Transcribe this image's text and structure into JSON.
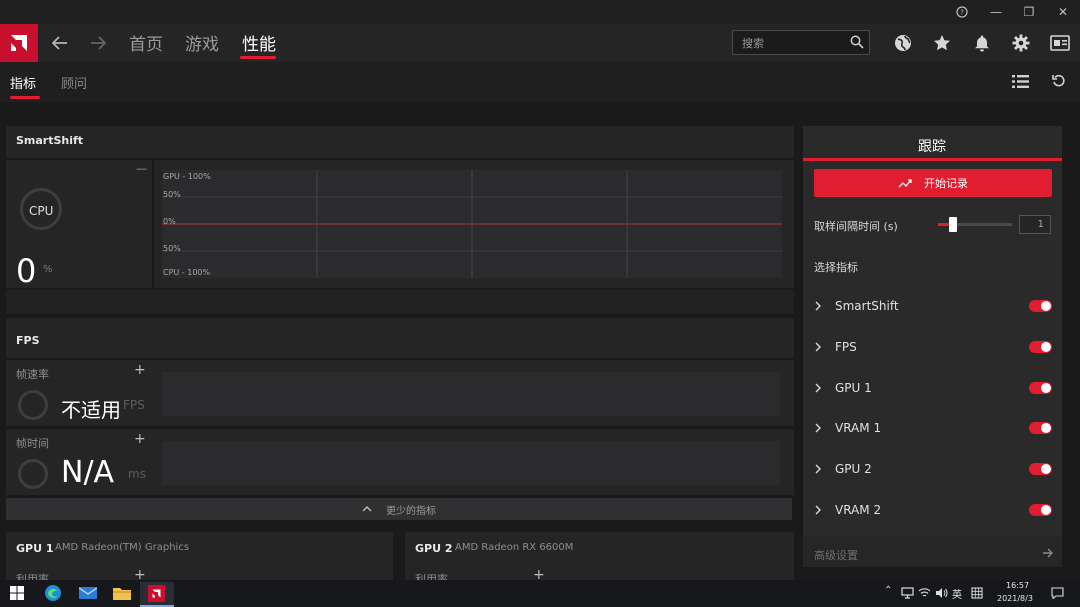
{
  "window": {
    "help_icon": "question-circle-icon",
    "minimize": "—",
    "restore": "❐",
    "close": "✕"
  },
  "nav": {
    "tabs": [
      {
        "label": "首页",
        "active": false
      },
      {
        "label": "游戏",
        "active": false
      },
      {
        "label": "性能",
        "active": true
      }
    ],
    "search_placeholder": "搜索",
    "accent": "#e11d32"
  },
  "subnav": {
    "tabs": [
      {
        "label": "指标",
        "active": true
      },
      {
        "label": "顾问",
        "active": false
      }
    ]
  },
  "smartshift": {
    "title": "SmartShift",
    "gauge_label": "CPU",
    "value": "0",
    "unit": "%",
    "collapse": "—",
    "graph_labels": [
      "GPU - 100%",
      "50%",
      "0%",
      "50%",
      "CPU - 100%"
    ]
  },
  "fps": {
    "title": "FPS",
    "rows": [
      {
        "label": "帧速率",
        "value": "不适用",
        "unit": "FPS",
        "add": "+"
      },
      {
        "label": "帧时间",
        "value": "N/A",
        "unit": "ms",
        "add": "+"
      }
    ],
    "fewer_metrics": "更少的指标"
  },
  "gpu_cards": [
    {
      "title": "GPU 1",
      "name": "AMD Radeon(TM) Graphics",
      "sub": "利用率",
      "add": "+"
    },
    {
      "title": "GPU 2",
      "name": "AMD Radeon RX 6600M",
      "sub": "利用率",
      "add": "+"
    }
  ],
  "tracking": {
    "title": "跟踪",
    "start_button": "开始记录",
    "interval_label": "取样间隔时间 (s)",
    "interval_value": "1",
    "select_metrics": "选择指标",
    "metrics": [
      {
        "label": "SmartShift",
        "enabled": true
      },
      {
        "label": "FPS",
        "enabled": true
      },
      {
        "label": "GPU 1",
        "enabled": true
      },
      {
        "label": "VRAM 1",
        "enabled": true
      },
      {
        "label": "GPU 2",
        "enabled": true
      },
      {
        "label": "VRAM 2",
        "enabled": true
      }
    ],
    "advanced": "高级设置"
  },
  "taskbar": {
    "ime": "英",
    "time": "16:57",
    "date": "2021/8/3"
  }
}
